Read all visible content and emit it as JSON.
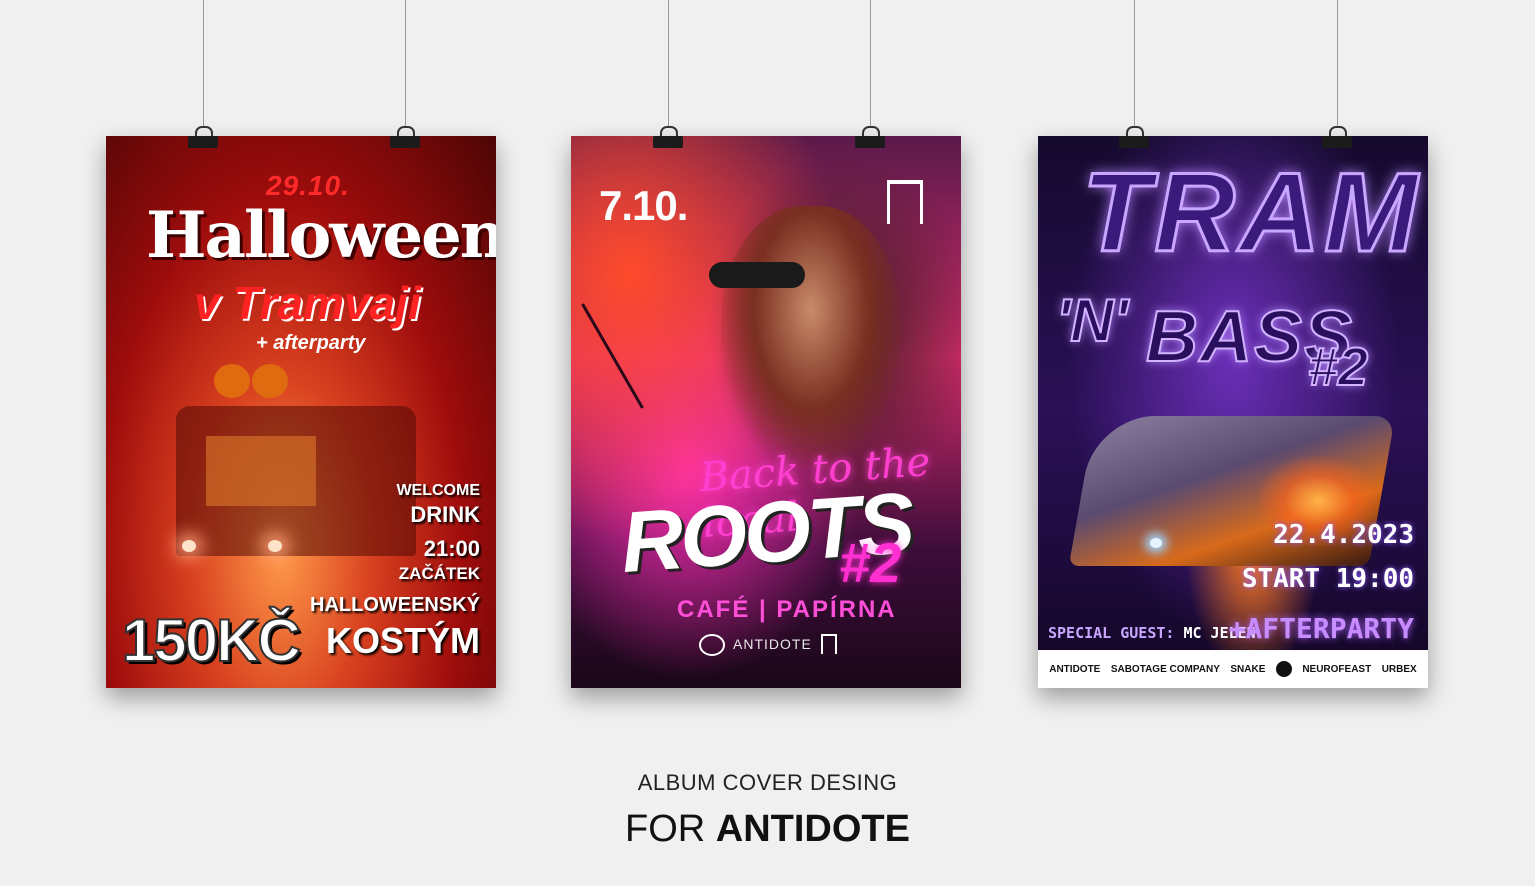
{
  "posters": [
    {
      "date": "29.10.",
      "title": "Halloween",
      "subtitle": "v Tramvaji",
      "extra": "+ afterparty",
      "info_welcome": "WELCOME",
      "info_drink": "DRINK",
      "info_time": "21:00",
      "info_start": "ZAČÁTEK",
      "info_costume1": "HALLOWEENSKÝ",
      "info_costume2": "KOSTÝM",
      "price": "150KČ"
    },
    {
      "date": "7.10.",
      "tagline": "Back to the local",
      "title": "ROOTS",
      "number": "#2",
      "venue": "CAFÉ | PAPÍRNA",
      "logo_text": "ANTIDOTE"
    },
    {
      "title_top": "TRAM",
      "title_mid": "'N'",
      "title_bottom": "BASS",
      "number": "#2",
      "date": "22.4.2023",
      "start": "START 19:00",
      "guest_label": "SPECIAL GUEST:",
      "guest_name": "MC JELEN",
      "afterparty": "+AFTERPARTY",
      "sponsors": [
        "ANTIDOTE",
        "SABOTAGE COMPANY",
        "SNAKE",
        "NEUROFEAST",
        "URBEX"
      ]
    }
  ],
  "caption": {
    "line1": "ALBUM COVER DESING",
    "line2_prefix": "FOR",
    "line2_bold": "ANTIDOTE"
  }
}
